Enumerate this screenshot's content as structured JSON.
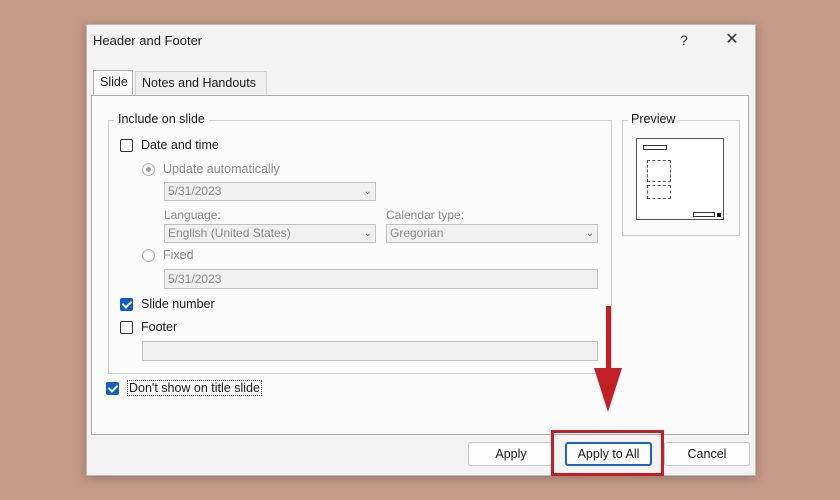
{
  "dialog": {
    "title": "Header and Footer",
    "help_label": "?",
    "close_label": "✕"
  },
  "tabs": [
    {
      "label": "Slide",
      "active": true
    },
    {
      "label": "Notes and Handouts",
      "active": false
    }
  ],
  "include_group": {
    "title": "Include on slide",
    "date_time": {
      "label": "Date and time",
      "checked": false
    },
    "update_auto": {
      "label": "Update automatically",
      "selected": true,
      "value": "5/31/2023"
    },
    "language": {
      "label": "Language:",
      "value": "English (United States)"
    },
    "calendar": {
      "label": "Calendar type:",
      "value": "Gregorian"
    },
    "fixed": {
      "label": "Fixed",
      "selected": false,
      "value": "5/31/2023"
    },
    "slide_number": {
      "label": "Slide number",
      "checked": true
    },
    "footer": {
      "label": "Footer",
      "checked": false,
      "value": ""
    }
  },
  "dont_show_title": {
    "label": "Don't show on title slide",
    "checked": true
  },
  "preview": {
    "title": "Preview"
  },
  "buttons": {
    "apply": "Apply",
    "apply_all": "Apply to All",
    "cancel": "Cancel"
  },
  "annotation_color": "#c21f24",
  "checkbox_accent": "#0f5fc7"
}
